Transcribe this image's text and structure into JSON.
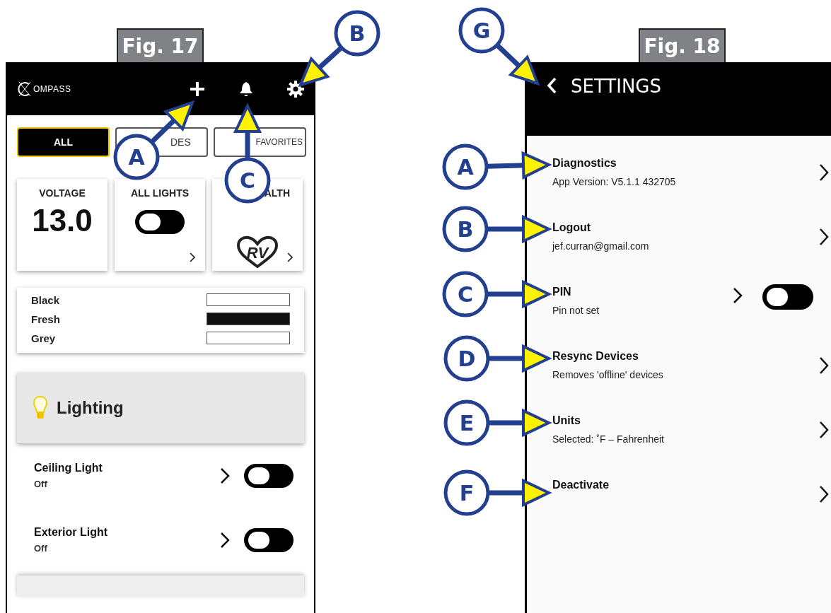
{
  "fig17": {
    "label": "Fig. 17",
    "logo": "OMPASS",
    "tabs": [
      {
        "label": "ALL",
        "selected": true
      },
      {
        "label": "DES",
        "selected": false
      },
      {
        "label": "FAVORITES",
        "selected": false
      }
    ],
    "cards": [
      {
        "kind": "reading",
        "title": "VOLTAGE",
        "value": "13.0"
      },
      {
        "kind": "toggle",
        "title": "ALL LIGHTS",
        "on": false
      },
      {
        "kind": "logo",
        "title": "ALTH",
        "logo_text": "RV"
      }
    ],
    "tanks": [
      {
        "name": "Black",
        "level": 0
      },
      {
        "name": "Fresh",
        "level": 1
      },
      {
        "name": "Grey",
        "level": 0
      }
    ],
    "section": {
      "title": "Lighting"
    },
    "lights": [
      {
        "name": "Ceiling Light",
        "status": "Off",
        "on": false
      },
      {
        "name": "Exterior Light",
        "status": "Off",
        "on": false
      }
    ],
    "callouts": [
      {
        "letter": "A"
      },
      {
        "letter": "B"
      },
      {
        "letter": "C"
      }
    ]
  },
  "fig18": {
    "label": "Fig. 18",
    "title": "SETTINGS",
    "items": [
      {
        "kind": "link",
        "title": "Diagnostics",
        "subtitle": "App Version: V5.1.1 432705"
      },
      {
        "kind": "link",
        "title": "Logout",
        "subtitle": "jef.curran@gmail.com"
      },
      {
        "kind": "toggle",
        "title": "PIN",
        "subtitle": "Pin not set",
        "on": false
      },
      {
        "kind": "link",
        "title": "Resync Devices",
        "subtitle": "Removes 'offline' devices"
      },
      {
        "kind": "link",
        "title": "Units",
        "subtitle": "Selected: ˚F – Fahrenheit"
      },
      {
        "kind": "link",
        "title": "Deactivate"
      }
    ],
    "callouts": [
      {
        "letter": "G"
      },
      {
        "letter": "A"
      },
      {
        "letter": "B"
      },
      {
        "letter": "C"
      },
      {
        "letter": "D"
      },
      {
        "letter": "E"
      },
      {
        "letter": "F"
      }
    ]
  }
}
